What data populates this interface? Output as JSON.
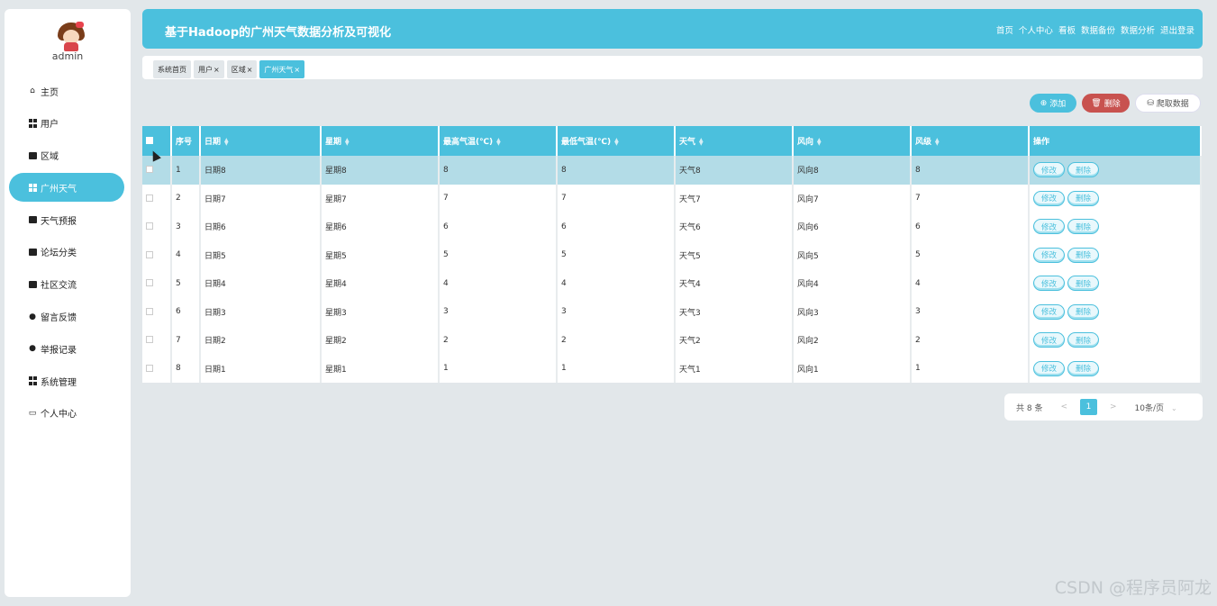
{
  "sidebar": {
    "username": "admin",
    "items": [
      {
        "label": "主页",
        "icon": "home-icon",
        "active": false
      },
      {
        "label": "用户",
        "icon": "grid-icon",
        "active": false
      },
      {
        "label": "区域",
        "icon": "clipboard-icon",
        "active": false
      },
      {
        "label": "广州天气",
        "icon": "grid-icon",
        "active": true
      },
      {
        "label": "天气预报",
        "icon": "ticket-icon",
        "active": false
      },
      {
        "label": "论坛分类",
        "icon": "briefcase-icon",
        "active": false
      },
      {
        "label": "社区交流",
        "icon": "book-icon",
        "active": false
      },
      {
        "label": "留言反馈",
        "icon": "user-icon",
        "active": false
      },
      {
        "label": "举报记录",
        "icon": "pin-icon",
        "active": false
      },
      {
        "label": "系统管理",
        "icon": "grid-icon",
        "active": false
      },
      {
        "label": "个人中心",
        "icon": "calendar-icon",
        "active": false
      }
    ]
  },
  "header": {
    "title": "基于Hadoop的广州天气数据分析及可视化",
    "nav": [
      "首页",
      "个人中心",
      "看板",
      "数据备份",
      "数据分析",
      "退出登录"
    ]
  },
  "tabs": [
    {
      "label": "系统首页",
      "closable": false,
      "active": false
    },
    {
      "label": "用户",
      "closable": true,
      "active": false
    },
    {
      "label": "区域",
      "closable": true,
      "active": false
    },
    {
      "label": "广州天气",
      "closable": true,
      "active": true
    }
  ],
  "toolbar": {
    "add_label": "添加",
    "delete_label": "删除",
    "crawl_label": "爬取数据"
  },
  "table": {
    "columns": [
      "序号",
      "日期",
      "星期",
      "最高气温(℃)",
      "最低气温(℃)",
      "天气",
      "风向",
      "风级",
      "操作"
    ],
    "edit_label": "修改",
    "delete_label": "删除",
    "rows": [
      [
        "1",
        "日期8",
        "星期8",
        "8",
        "8",
        "天气8",
        "风向8",
        "8"
      ],
      [
        "2",
        "日期7",
        "星期7",
        "7",
        "7",
        "天气7",
        "风向7",
        "7"
      ],
      [
        "3",
        "日期6",
        "星期6",
        "6",
        "6",
        "天气6",
        "风向6",
        "6"
      ],
      [
        "4",
        "日期5",
        "星期5",
        "5",
        "5",
        "天气5",
        "风向5",
        "5"
      ],
      [
        "5",
        "日期4",
        "星期4",
        "4",
        "4",
        "天气4",
        "风向4",
        "4"
      ],
      [
        "6",
        "日期3",
        "星期3",
        "3",
        "3",
        "天气3",
        "风向3",
        "3"
      ],
      [
        "7",
        "日期2",
        "星期2",
        "2",
        "2",
        "天气2",
        "风向2",
        "2"
      ],
      [
        "8",
        "日期1",
        "星期1",
        "1",
        "1",
        "天气1",
        "风向1",
        "1"
      ]
    ]
  },
  "pagination": {
    "total": "共 8 条",
    "prev": "<",
    "current": "1",
    "next": ">",
    "page_size": "10条/页"
  },
  "watermark": "CSDN @程序员阿龙",
  "colors": {
    "accent": "#4bc0dd",
    "danger": "#c8524f",
    "background": "#e2e7ea"
  }
}
